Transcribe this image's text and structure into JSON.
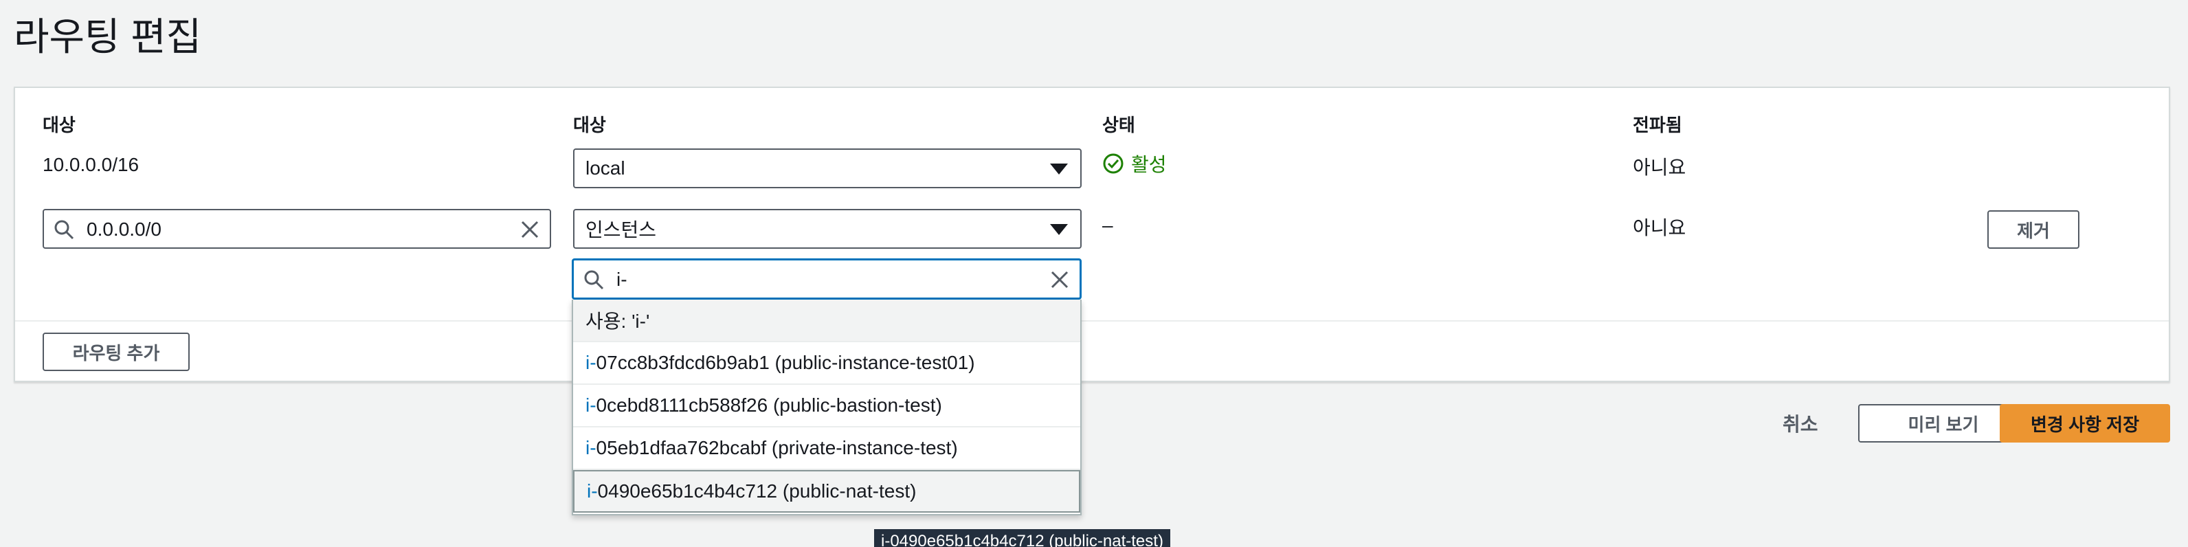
{
  "page": {
    "title": "라우팅 편집"
  },
  "table": {
    "headers": [
      "대상",
      "대상",
      "상태",
      "전파됨"
    ],
    "rows": [
      {
        "destination": "10.0.0.0/16",
        "target": "local",
        "status": "활성",
        "propagated": "아니요"
      },
      {
        "destination": "0.0.0.0/0",
        "target": "인스턴스",
        "target_search": "i-",
        "status": "–",
        "propagated": "아니요",
        "remove_label": "제거"
      }
    ]
  },
  "dropdown": {
    "use_option": "사용: 'i-'",
    "match_prefix": "i-",
    "items": [
      {
        "rest": "07cc8b3fdcd6b9ab1 (public-instance-test01)"
      },
      {
        "rest": "0cebd8111cb588f26 (public-bastion-test)"
      },
      {
        "rest": "05eb1dfaa762bcabf (private-instance-test)"
      },
      {
        "rest": "0490e65b1c4b4c712 (public-nat-test)"
      }
    ]
  },
  "actions": {
    "add_route": "라우팅 추가",
    "cancel": "취소",
    "preview": "미리 보기",
    "save": "변경 사항 저장"
  },
  "tooltip": "i-0490e65b1c4b4c712 (public-nat-test)",
  "colors": {
    "accent": "#0073bb",
    "primary": "#ec9531",
    "success": "#1d8102"
  }
}
